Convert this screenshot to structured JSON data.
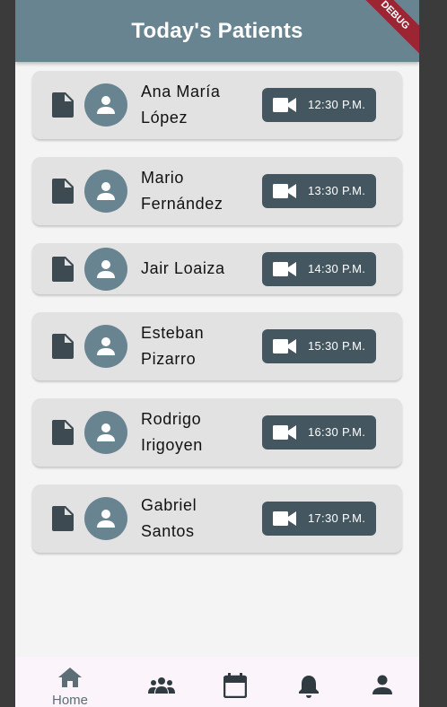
{
  "app": {
    "title": "Today's Patients",
    "debug_banner": "DEBUG"
  },
  "colors": {
    "appbar": "#698491",
    "card": "#e2e2e2",
    "call_button": "#445760",
    "avatar": "#698491",
    "background": "#f4f4f4",
    "bottom_nav": "#fbf4fb"
  },
  "patients": [
    {
      "name": "Ana María López",
      "time": "12:30 P.M."
    },
    {
      "name": "Mario Fernández",
      "time": "13:30 P.M."
    },
    {
      "name": "Jair Loaiza",
      "time": "14:30 P.M."
    },
    {
      "name": "Esteban Pizarro",
      "time": "15:30 P.M."
    },
    {
      "name": "Rodrigo Irigoyen",
      "time": "16:30 P.M."
    },
    {
      "name": "Gabriel Santos",
      "time": "17:30 P.M."
    }
  ],
  "bottom_nav": {
    "items": [
      {
        "label": "Home",
        "icon": "home-icon",
        "selected": true
      },
      {
        "label": "",
        "icon": "groups-icon",
        "selected": false
      },
      {
        "label": "",
        "icon": "calendar-icon",
        "selected": false
      },
      {
        "label": "",
        "icon": "bell-icon",
        "selected": false
      },
      {
        "label": "",
        "icon": "person-icon",
        "selected": false
      }
    ]
  }
}
